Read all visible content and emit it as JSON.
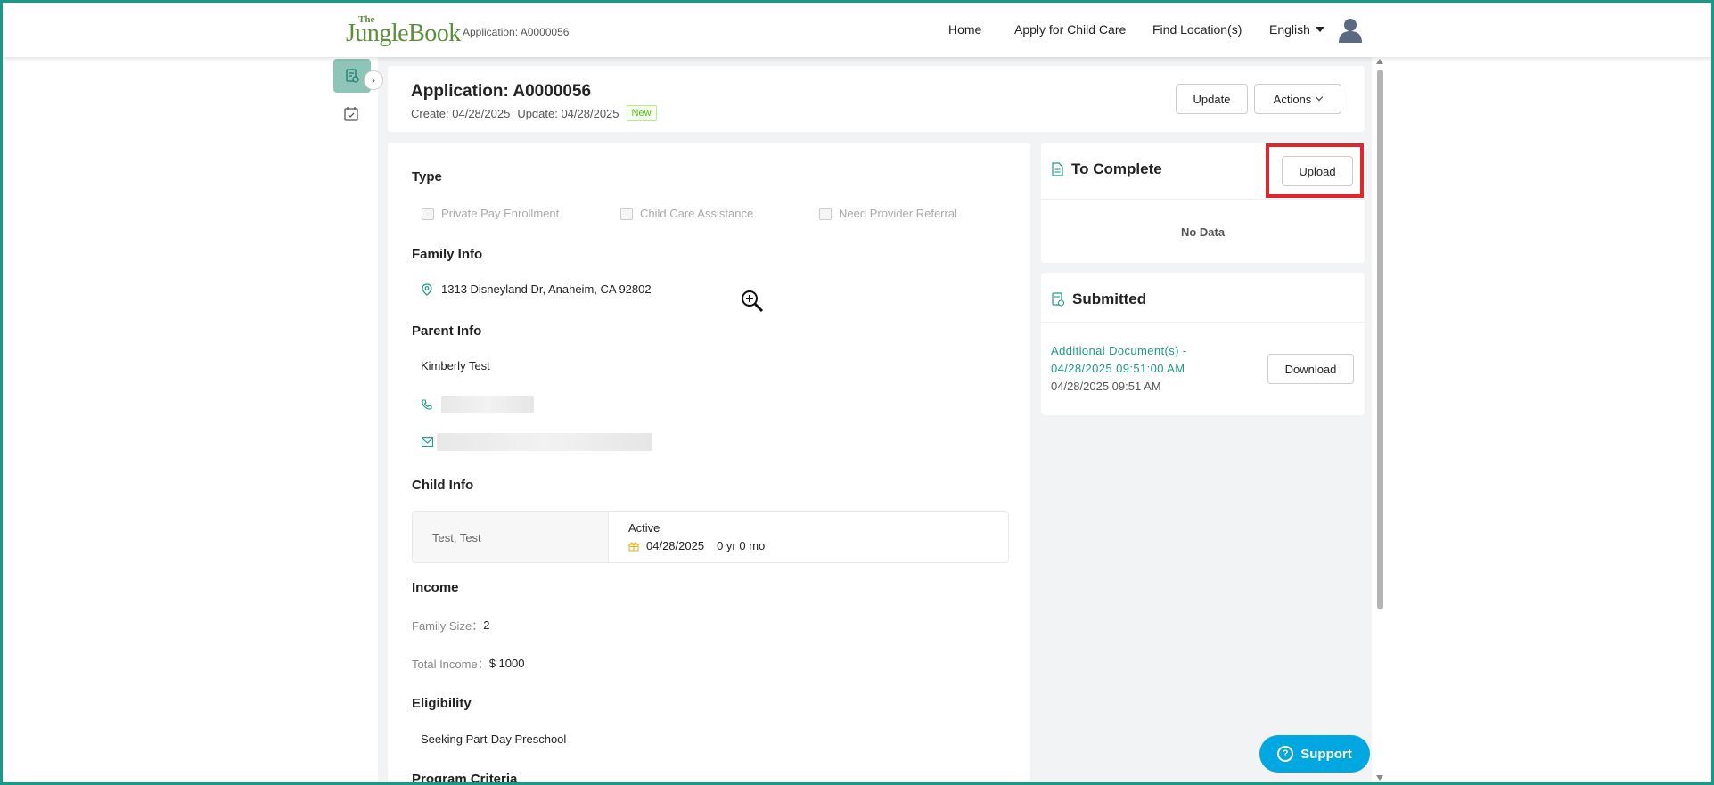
{
  "header": {
    "logo_the": "The",
    "logo_main": "JungleBook",
    "application_small": "Application: A0000056",
    "nav": {
      "home": "Home",
      "apply": "Apply for Child Care",
      "find": "Find Location(s)"
    },
    "language": "English"
  },
  "application": {
    "title": "Application: A0000056",
    "create": "Create: 04/28/2025",
    "update": "Update: 04/28/2025",
    "status": "New",
    "update_button": "Update",
    "actions_button": "Actions"
  },
  "details": {
    "type_title": "Type",
    "type_options": [
      "Private Pay Enrollment",
      "Child Care Assistance",
      "Need Provider Referral"
    ],
    "family_title": "Family Info",
    "address": "1313 Disneyland Dr, Anaheim, CA 92802",
    "parent_title": "Parent Info",
    "parent_name": "Kimberly Test",
    "child_title": "Child Info",
    "child_name": "Test, Test",
    "child_status": "Active",
    "child_dob": "04/28/2025",
    "child_age": "0 yr 0 mo",
    "income_title": "Income",
    "family_size_label": "Family Size：",
    "family_size": "2",
    "total_income_label": "Total Income：",
    "total_income": "$ 1000",
    "eligibility_title": "Eligibility",
    "eligibility": "Seeking Part-Day Preschool",
    "program_title": "Program Criteria"
  },
  "to_complete": {
    "title": "To Complete",
    "upload_button": "Upload",
    "empty": "No Data"
  },
  "submitted": {
    "title": "Submitted",
    "doc_line1": "Additional Document(s) -",
    "doc_line2": "04/28/2025 09:51:00 AM",
    "doc_date": "04/28/2025 09:51 AM",
    "download_button": "Download"
  },
  "support": {
    "label": "Support"
  },
  "colors": {
    "accent": "#1a9a86",
    "highlight": "#e0262b",
    "support": "#00a7e1",
    "logo": "#5a8f3a"
  }
}
